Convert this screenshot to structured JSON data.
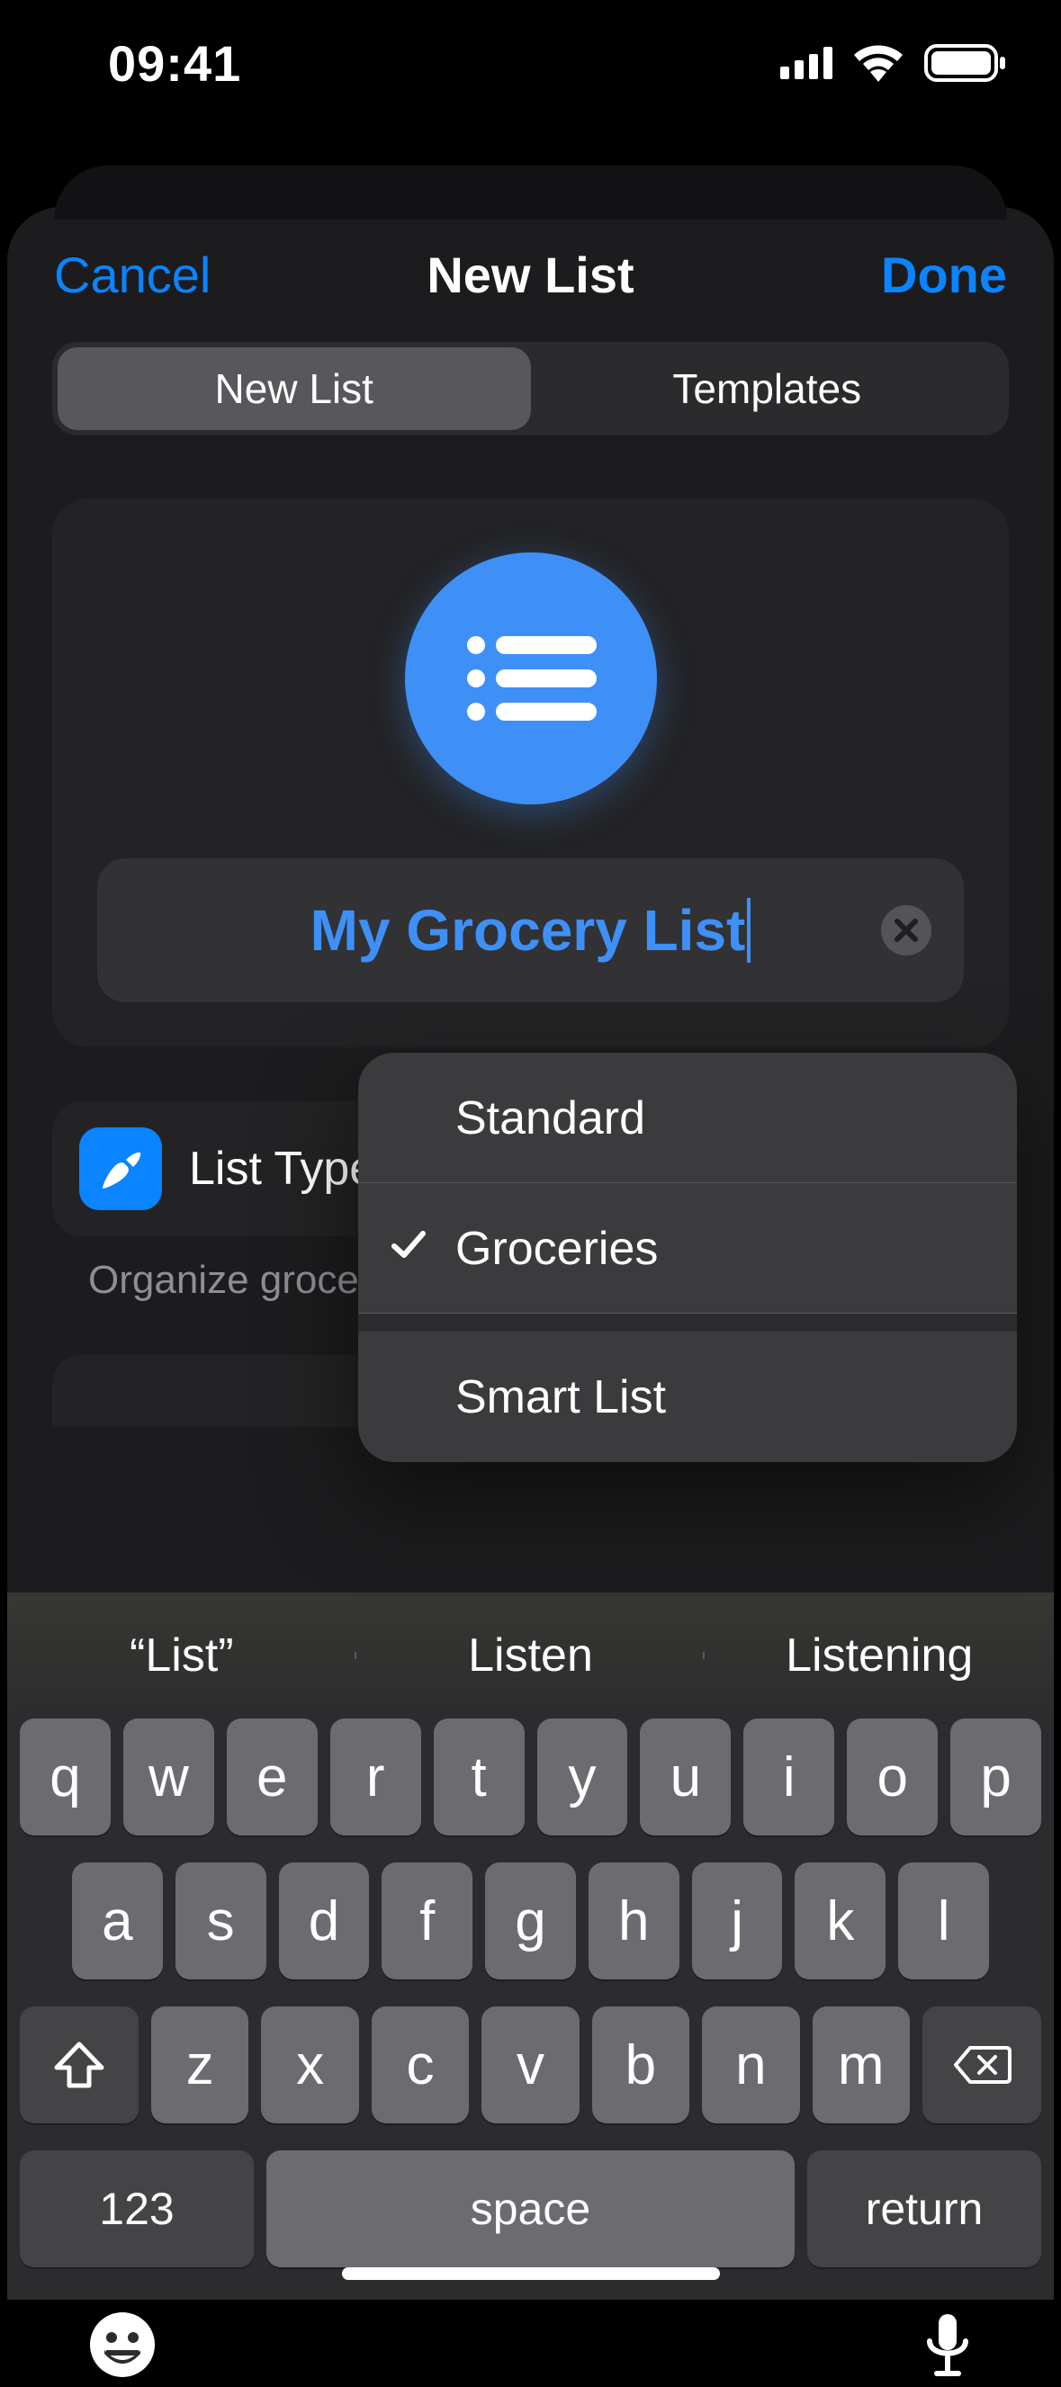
{
  "status": {
    "time": "09:41"
  },
  "nav": {
    "cancel": "Cancel",
    "title": "New List",
    "done": "Done"
  },
  "segmented": {
    "new_list": "New List",
    "templates": "Templates"
  },
  "list": {
    "name": "My Grocery List",
    "type_label": "List Type",
    "hint_prefix": "Organize grocer"
  },
  "popup": {
    "items": [
      {
        "label": "Standard",
        "checked": false
      },
      {
        "label": "Groceries",
        "checked": true
      },
      {
        "label": "Smart List",
        "checked": false
      }
    ]
  },
  "predict": {
    "a": "“List”",
    "b": "Listen",
    "c": "Listening"
  },
  "keys": {
    "row1": [
      "q",
      "w",
      "e",
      "r",
      "t",
      "y",
      "u",
      "i",
      "o",
      "p"
    ],
    "row2": [
      "a",
      "s",
      "d",
      "f",
      "g",
      "h",
      "j",
      "k",
      "l"
    ],
    "row3": [
      "z",
      "x",
      "c",
      "v",
      "b",
      "n",
      "m"
    ],
    "numbers": "123",
    "space": "space",
    "return": "return"
  }
}
